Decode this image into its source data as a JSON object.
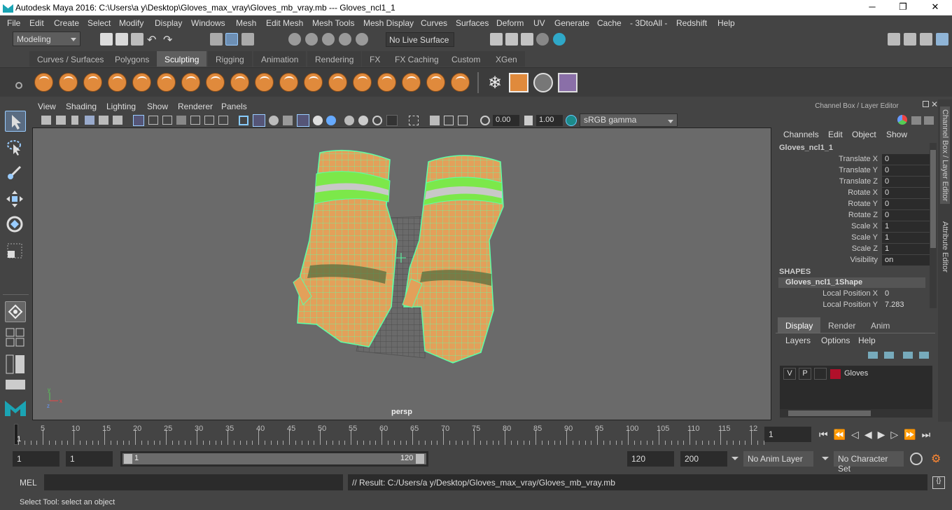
{
  "window": {
    "title": "Autodesk Maya 2016: C:\\Users\\a y\\Desktop\\Gloves_max_vray\\Gloves_mb_vray.mb   ---   Gloves_ncl1_1",
    "minimize": "─",
    "maximize": "❐",
    "close": "✕"
  },
  "menu": [
    "File",
    "Edit",
    "Create",
    "Select",
    "Modify",
    "Display",
    "Windows",
    "Mesh",
    "Edit Mesh",
    "Mesh Tools",
    "Mesh Display",
    "Curves",
    "Surfaces",
    "Deform",
    "UV",
    "Generate",
    "Cache",
    "- 3DtoAll -",
    "Redshift",
    "Help"
  ],
  "statusline": {
    "mode": "Modeling",
    "live_surface": "No Live Surface"
  },
  "shelf_tabs": [
    "Curves / Surfaces",
    "Polygons",
    "Sculpting",
    "Rigging",
    "Animation",
    "Rendering",
    "FX",
    "FX Caching",
    "Custom",
    "XGen"
  ],
  "shelf_active": "Sculpting",
  "viewport": {
    "menu": [
      "View",
      "Shading",
      "Lighting",
      "Show",
      "Renderer",
      "Panels"
    ],
    "gamma_value": "0.00",
    "exposure_value": "1.00",
    "color_space": "sRGB gamma",
    "camera_label": "persp"
  },
  "channel_box": {
    "title": "Channel Box / Layer Editor",
    "menu": [
      "Channels",
      "Edit",
      "Object",
      "Show"
    ],
    "object_name": "Gloves_ncl1_1",
    "attributes": [
      {
        "name": "Translate X",
        "value": "0"
      },
      {
        "name": "Translate Y",
        "value": "0"
      },
      {
        "name": "Translate Z",
        "value": "0"
      },
      {
        "name": "Rotate X",
        "value": "0"
      },
      {
        "name": "Rotate Y",
        "value": "0"
      },
      {
        "name": "Rotate Z",
        "value": "0"
      },
      {
        "name": "Scale X",
        "value": "1"
      },
      {
        "name": "Scale Y",
        "value": "1"
      },
      {
        "name": "Scale Z",
        "value": "1"
      },
      {
        "name": "Visibility",
        "value": "on"
      }
    ],
    "shapes_header": "SHAPES",
    "shape_name": "Gloves_ncl1_1Shape",
    "shape_attributes": [
      {
        "name": "Local Position X",
        "value": "0"
      },
      {
        "name": "Local Position Y",
        "value": "7.283"
      }
    ]
  },
  "side_tabs": [
    "Channel Box / Layer Editor",
    "Attribute Editor"
  ],
  "layer_editor": {
    "tabs": [
      "Display",
      "Render",
      "Anim"
    ],
    "active_tab": "Display",
    "menu": [
      "Layers",
      "Options",
      "Help"
    ],
    "layers": [
      {
        "v": "V",
        "p": "P",
        "name": "Gloves",
        "color": "#b0102a"
      }
    ]
  },
  "timeline": {
    "ticks": [
      "5",
      "10",
      "15",
      "20",
      "25",
      "30",
      "35",
      "40",
      "45",
      "50",
      "55",
      "60",
      "65",
      "70",
      "75",
      "80",
      "85",
      "90",
      "95",
      "100",
      "105",
      "110",
      "115",
      "12"
    ],
    "current_frame_label": "1",
    "current_frame": "1"
  },
  "range": {
    "start": "1",
    "playback_start": "1",
    "slider_start": "1",
    "slider_end": "120",
    "playback_end": "120",
    "end": "200",
    "anim_layer": "No Anim Layer",
    "character_set": "No Character Set"
  },
  "command": {
    "label": "MEL",
    "result": "// Result: C:/Users/a y/Desktop/Gloves_max_vray/Gloves_mb_vray.mb"
  },
  "help_line": "Select Tool: select an object",
  "colors": {
    "accent": "#5e5e5e",
    "wire": "#5dffa6",
    "glove": "#e3a05a",
    "band": "#7ce84a"
  }
}
